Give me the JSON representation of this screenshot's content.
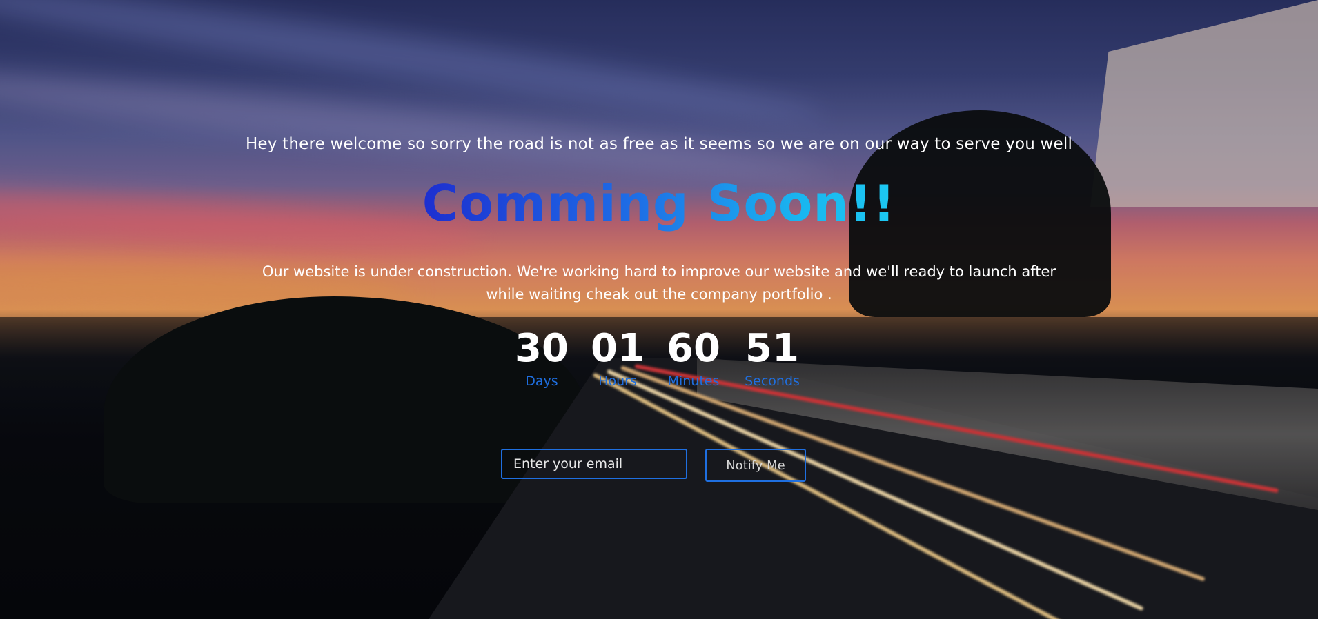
{
  "page": {
    "tagline": "Hey there welcome so sorry the road is not as free as it seems so we are on our way to serve you well",
    "headline": "Comming Soon!!",
    "description": "Our website is under construction. We're working hard to improve our website and we'll ready to launch after while waiting cheak out the company portfolio ."
  },
  "countdown": {
    "days": {
      "value": "30",
      "label": "Days"
    },
    "hours": {
      "value": "01",
      "label": "Hours"
    },
    "minutes": {
      "value": "60",
      "label": "Minutes"
    },
    "seconds": {
      "value": "51",
      "label": "Seconds"
    }
  },
  "form": {
    "email_placeholder": "Enter your email",
    "submit_label": "Notify Me"
  },
  "colors": {
    "accent": "#1f6fe0",
    "headline_start": "#1d2fd0",
    "headline_end": "#1cc9f2"
  }
}
